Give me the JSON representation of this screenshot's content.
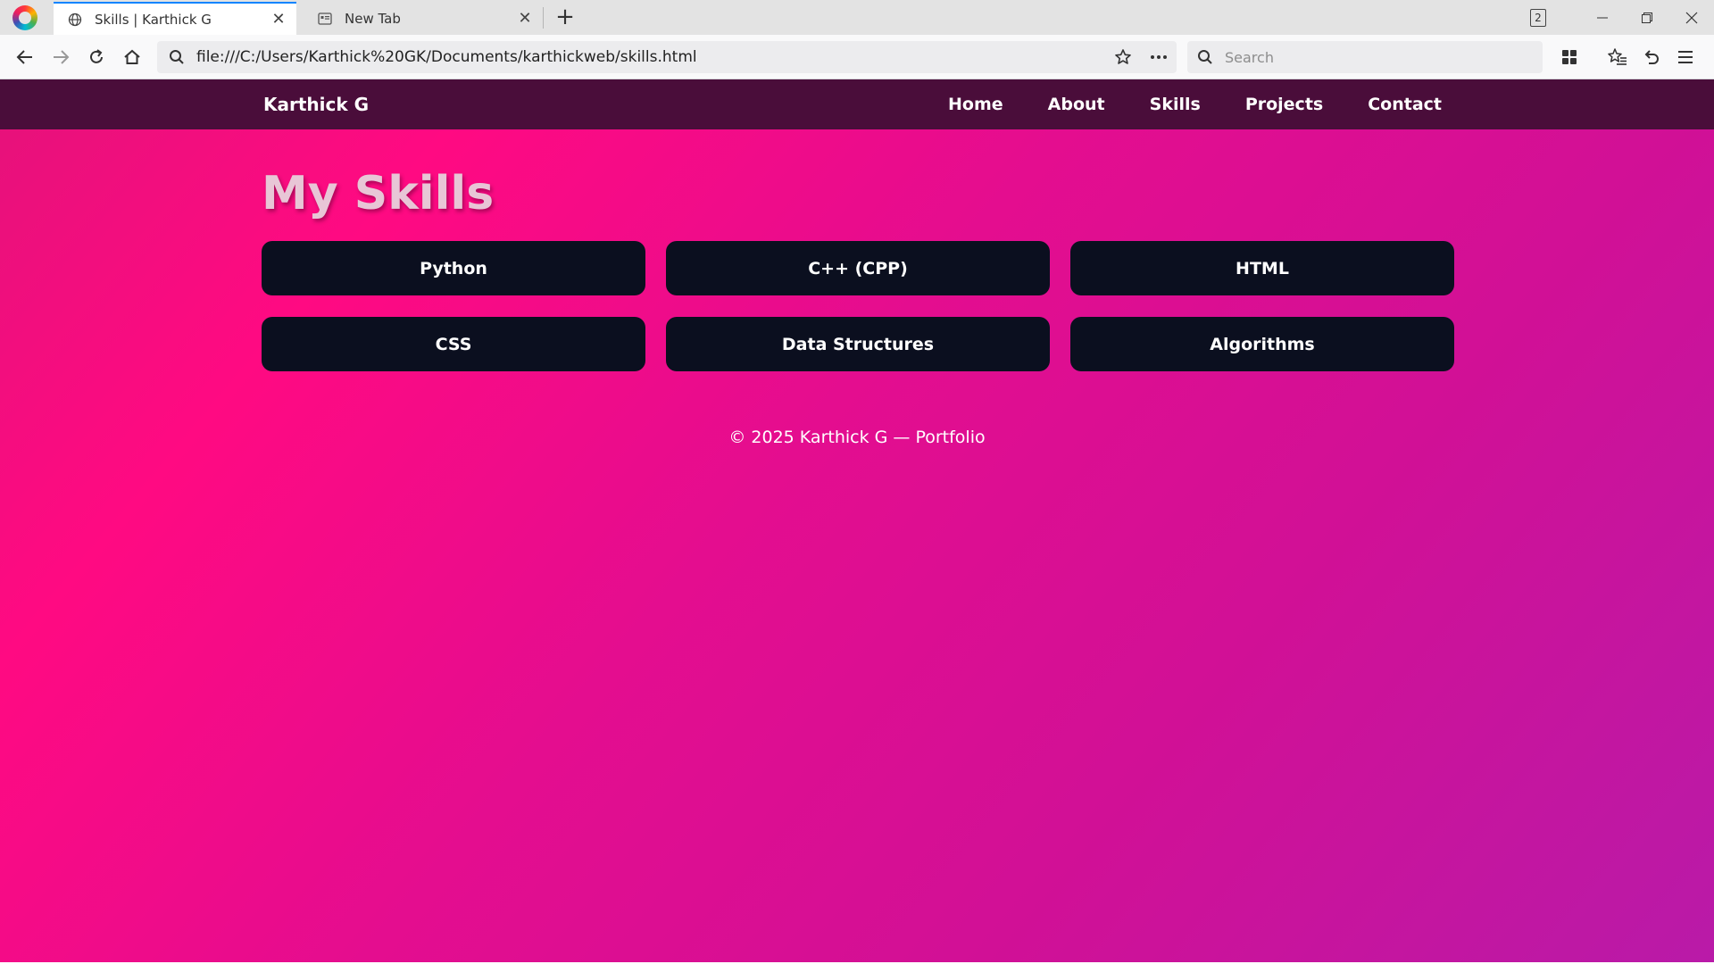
{
  "browser": {
    "tabs": [
      {
        "title": "Skills | Karthick G",
        "active": true,
        "icon": "globe-icon"
      },
      {
        "title": "New Tab",
        "active": false,
        "icon": "new-tab-page-icon"
      }
    ],
    "tab_count": "2",
    "url": "file:///C:/Users/Karthick%20GK/Documents/karthickweb/skills.html",
    "search_placeholder": "Search"
  },
  "site": {
    "brand": "Karthick G",
    "nav": [
      "Home",
      "About",
      "Skills",
      "Projects",
      "Contact"
    ]
  },
  "main": {
    "title": "My Skills",
    "skills": [
      "Python",
      "C++ (CPP)",
      "HTML",
      "CSS",
      "Data Structures",
      "Algorithms"
    ]
  },
  "footer": {
    "text": "© 2025 Karthick G — Portfolio"
  },
  "colors": {
    "header_bg": "#4a0d3a",
    "card_bg": "#0b0f1f",
    "gradient_start": "#ff0a82",
    "gradient_end": "#b91aa8",
    "title_color": "#e8c6d6"
  }
}
